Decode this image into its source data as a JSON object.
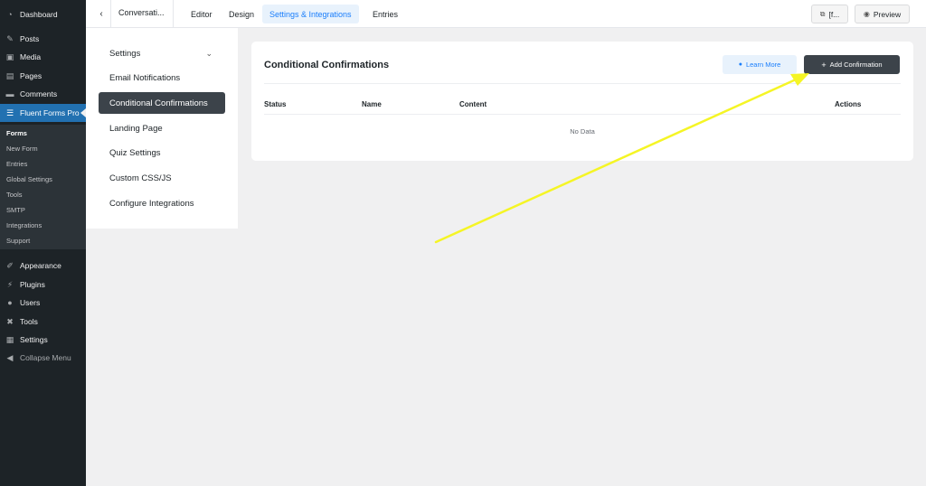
{
  "wp_menu": {
    "dashboard": "Dashboard",
    "posts": "Posts",
    "media": "Media",
    "pages": "Pages",
    "comments": "Comments",
    "fluent_forms": "Fluent Forms Pro",
    "sub": {
      "forms": "Forms",
      "new_form": "New Form",
      "entries": "Entries",
      "global_settings": "Global Settings",
      "tools": "Tools",
      "smtp": "SMTP",
      "integrations": "Integrations",
      "support": "Support"
    },
    "appearance": "Appearance",
    "plugins": "Plugins",
    "users": "Users",
    "tools": "Tools",
    "settings": "Settings",
    "collapse": "Collapse Menu"
  },
  "topbar": {
    "form_title": "Conversati...",
    "tabs": [
      "Editor",
      "Design",
      "Settings & Integrations",
      "Entries"
    ],
    "shortcode_label": "[f...",
    "preview_label": "Preview"
  },
  "settings_nav": {
    "items": [
      "Settings",
      "Email Notifications",
      "Conditional Confirmations",
      "Landing Page",
      "Quiz Settings",
      "Custom CSS/JS",
      "Configure Integrations"
    ]
  },
  "card": {
    "title": "Conditional Confirmations",
    "learn_more": "Learn More",
    "add_confirmation": "Add Confirmation",
    "columns": [
      "Status",
      "Name",
      "Content",
      "Actions"
    ],
    "empty_text": "No Data"
  },
  "colors": {
    "wp_sidebar": "#1d2327",
    "wp_active": "#2271b1",
    "accent": "#1a7efb",
    "dark_button": "#3c434a",
    "annotation_arrow": "#f5f525"
  }
}
